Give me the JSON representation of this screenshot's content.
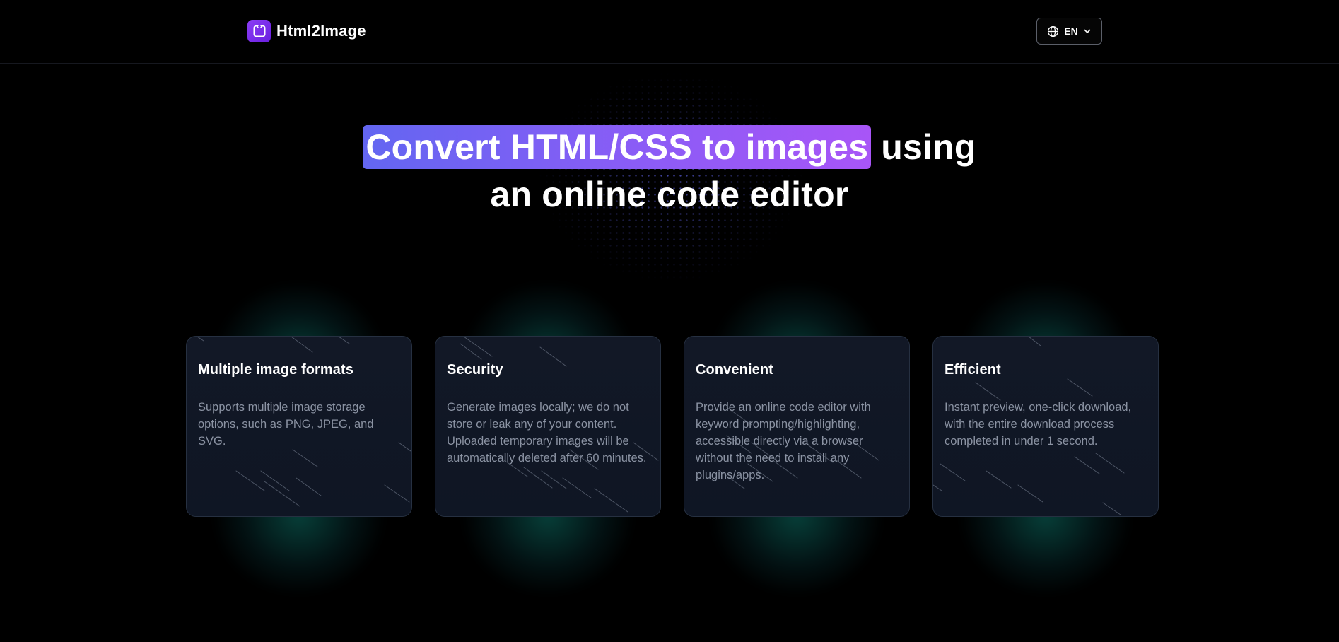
{
  "header": {
    "brand_name": "Html2Image",
    "language_label": "EN"
  },
  "hero": {
    "title_highlight": "Convert HTML/CSS to images",
    "title_rest_line1": "using",
    "title_line2": "an online code editor"
  },
  "features": [
    {
      "title": "Multiple image formats",
      "description": "Supports multiple image storage options, such as PNG, JPEG, and SVG."
    },
    {
      "title": "Security",
      "description": "Generate images locally; we do not store or leak any of your content. Uploaded temporary images will be automatically deleted after 60 minutes."
    },
    {
      "title": "Convenient",
      "description": "Provide an online code editor with keyword prompting/highlighting, accessible directly via a browser without the need to install any plugins/apps."
    },
    {
      "title": "Efficient",
      "description": "Instant preview, one-click download, with the entire download process completed in under 1 second."
    }
  ],
  "icons": {
    "brand": "code-bracket-icon",
    "language": "globe-icon",
    "dropdown": "chevron-down-icon"
  },
  "colors": {
    "background": "#000000",
    "brand_purple": "#7c3aed",
    "highlight_start": "#6366f1",
    "highlight_end": "#a855f7",
    "card_background": "#121826",
    "card_glow": "#14b8a6",
    "description_text": "#8b93a3"
  }
}
